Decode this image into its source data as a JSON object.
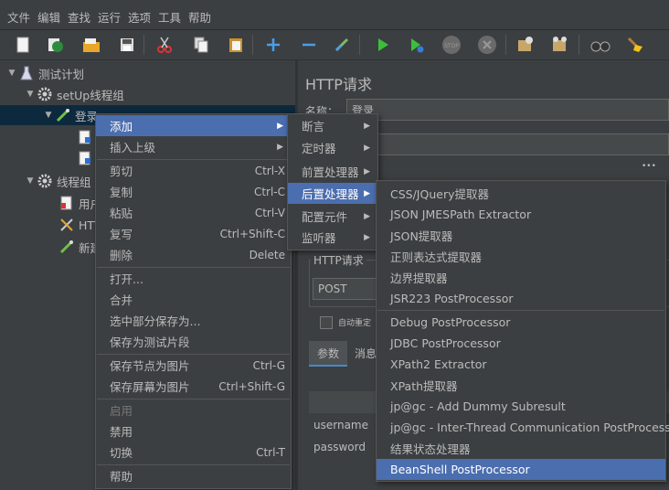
{
  "menubar": {
    "items": [
      "文件",
      "编辑",
      "查找",
      "运行",
      "选项",
      "工具",
      "帮助"
    ]
  },
  "toolbar": {
    "icons": [
      "new-icon",
      "templates-icon",
      "open-icon",
      "save-icon",
      "cut-icon",
      "copy-icon",
      "paste-icon",
      "expand-icon",
      "collapse-icon",
      "toggle-icon",
      "start-icon",
      "start-no-pause-icon",
      "stop-icon",
      "shutdown-icon",
      "clear-icon",
      "clear-all-icon",
      "search-icon",
      "reset-search-icon"
    ]
  },
  "tree": {
    "root": "测试计划",
    "setup_group": "setUp线程组",
    "login": "登录",
    "thread_group": "线程组",
    "child_user": "用户",
    "child_http": "HTT",
    "child_new": "新建"
  },
  "right": {
    "title": "HTTP请求",
    "name_label": "名称：",
    "name_value": "登录",
    "http_request_label": "HTTP请求",
    "method": "POST",
    "auto_redirect": "自动重定",
    "tab_params": "参数",
    "tab_body": "消息",
    "param_rows": [
      "username",
      "password"
    ],
    "dots": "•••"
  },
  "context_menu": {
    "items": [
      {
        "label": "添加",
        "shortcut": "",
        "submenu": true,
        "highlight": true
      },
      {
        "label": "插入上级",
        "shortcut": "",
        "submenu": true
      },
      {
        "sep": true
      },
      {
        "label": "剪切",
        "shortcut": "Ctrl-X"
      },
      {
        "label": "复制",
        "shortcut": "Ctrl-C"
      },
      {
        "label": "粘贴",
        "shortcut": "Ctrl-V"
      },
      {
        "label": "复写",
        "shortcut": "Ctrl+Shift-C"
      },
      {
        "label": "删除",
        "shortcut": "Delete"
      },
      {
        "sep": true
      },
      {
        "label": "打开..."
      },
      {
        "label": "合并"
      },
      {
        "label": "选中部分保存为..."
      },
      {
        "label": "保存为测试片段"
      },
      {
        "sep": true
      },
      {
        "label": "保存节点为图片",
        "shortcut": "Ctrl-G"
      },
      {
        "label": "保存屏幕为图片",
        "shortcut": "Ctrl+Shift-G"
      },
      {
        "sep": true
      },
      {
        "label": "启用",
        "disabled": true
      },
      {
        "label": "禁用"
      },
      {
        "label": "切换",
        "shortcut": "Ctrl-T"
      },
      {
        "sep": true
      },
      {
        "label": "帮助"
      }
    ]
  },
  "add_menu": {
    "items": [
      {
        "label": "断言"
      },
      {
        "label": "定时器"
      },
      {
        "label": "前置处理器"
      },
      {
        "label": "后置处理器",
        "highlight": true
      },
      {
        "label": "配置元件"
      },
      {
        "label": "监听器"
      }
    ]
  },
  "postprocessor_menu": {
    "items": [
      {
        "label": "CSS/JQuery提取器"
      },
      {
        "label": "JSON JMESPath Extractor"
      },
      {
        "label": "JSON提取器"
      },
      {
        "label": "正则表达式提取器"
      },
      {
        "label": "边界提取器"
      },
      {
        "label": "JSR223 PostProcessor"
      },
      {
        "sep": true
      },
      {
        "label": "Debug PostProcessor"
      },
      {
        "label": "JDBC PostProcessor"
      },
      {
        "label": "XPath2 Extractor"
      },
      {
        "label": "XPath提取器"
      },
      {
        "label": "jp@gc - Add Dummy Subresult"
      },
      {
        "label": "jp@gc - Inter-Thread Communication PostProcessor"
      },
      {
        "label": "结果状态处理器"
      },
      {
        "label": "BeanShell PostProcessor",
        "highlight": true
      }
    ]
  }
}
